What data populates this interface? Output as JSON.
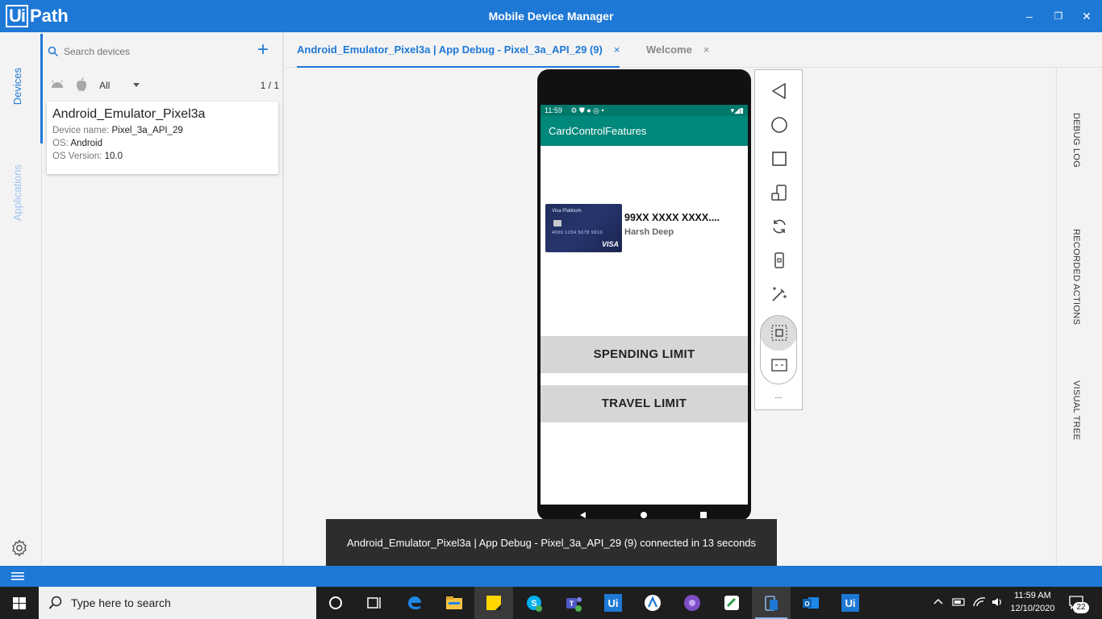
{
  "titlebar": {
    "logo_ui": "Ui",
    "logo_path": "Path",
    "title": "Mobile Device Manager",
    "minimize": "–",
    "restore": "❐",
    "close": "✕"
  },
  "nav": {
    "devices": "Devices",
    "applications": "Applications"
  },
  "device_panel": {
    "search_placeholder": "Search devices",
    "filter_value": "All",
    "count": "1 / 1",
    "device": {
      "name": "Android_Emulator_Pixel3a",
      "device_name_label": "Device name:",
      "device_name": "Pixel_3a_API_29",
      "os_label": "OS:",
      "os": "Android",
      "os_version_label": "OS Version:",
      "os_version": "10.0"
    }
  },
  "tabs": [
    {
      "label": "Android_Emulator_Pixel3a | App Debug - Pixel_3a_API_29 (9)",
      "close": "×"
    },
    {
      "label": "Welcome",
      "close": "×"
    }
  ],
  "right_panel": {
    "debug_log": "DEBUG LOG",
    "recorded_actions": "RECORDED ACTIONS",
    "visual_tree": "VISUAL TREE"
  },
  "phone": {
    "status_time": "11:59",
    "status_icons": "⚙ ⛊ ● ◎ •",
    "app_title": "CardControlFeatures",
    "card": {
      "tier": "Visa Platinum",
      "card_face_number": "4000 1234 5678 9010",
      "brand": "VISA",
      "number": "99XX XXXX XXXX....",
      "holder": "Harsh Deep"
    },
    "buttons": [
      "SPENDING LIMIT",
      "TRAVEL LIMIT"
    ]
  },
  "emulator_toolbar": {
    "more": "..."
  },
  "toast": {
    "message": "Android_Emulator_Pixel3a | App Debug - Pixel_3a_API_29 (9) connected in 13 seconds"
  },
  "taskbar": {
    "search_placeholder": "Type here to search",
    "time": "11:59 AM",
    "date": "12/10/2020",
    "notifications": "22"
  },
  "colors": {
    "accent": "#1e78d6",
    "app_bar": "#00897b",
    "taskbar": "#1e1e1e"
  }
}
